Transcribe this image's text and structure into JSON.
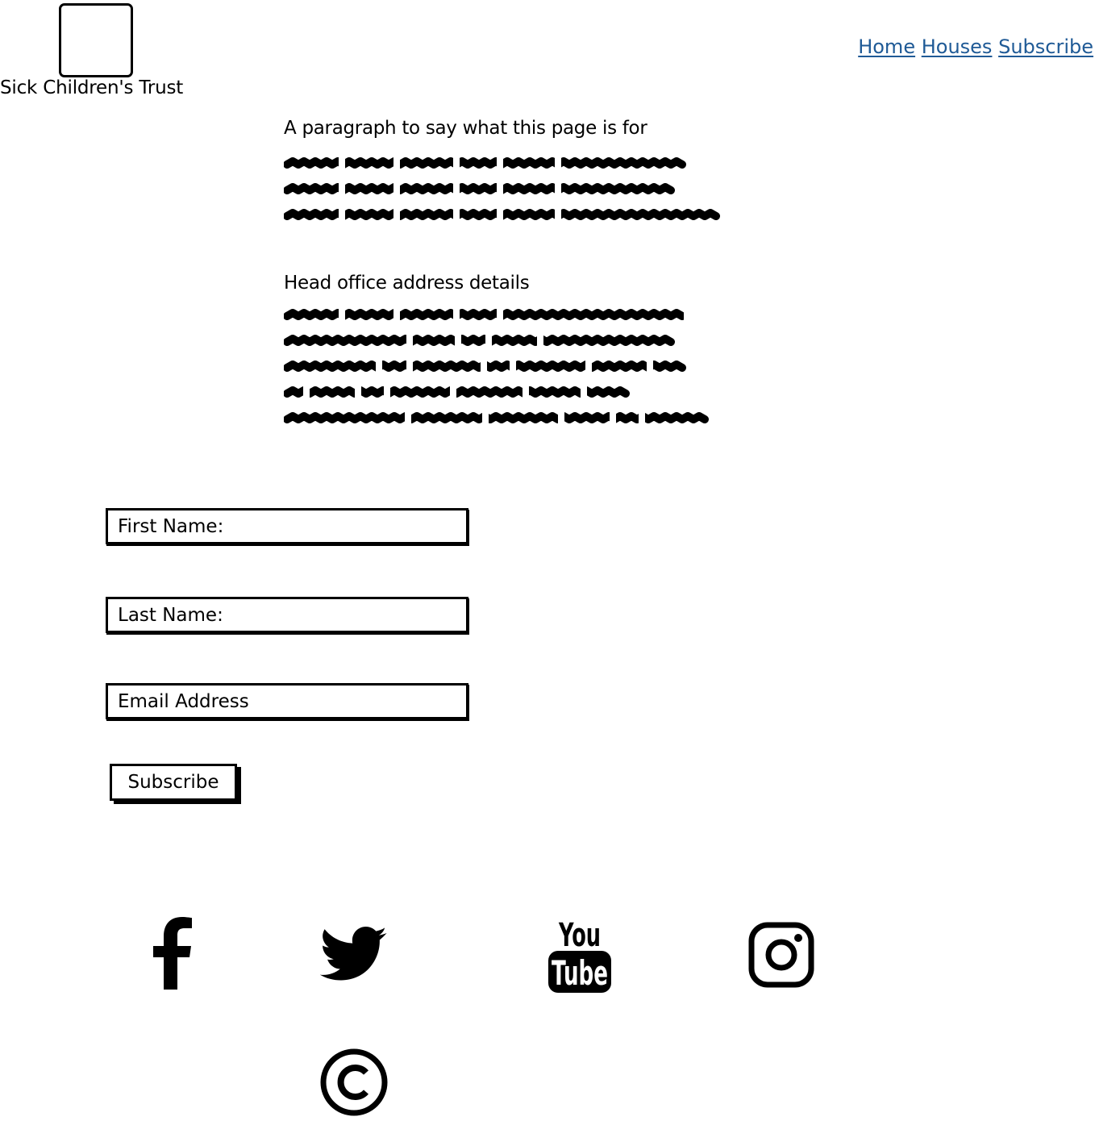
{
  "header": {
    "logo_text": "Sick Children's Trust",
    "nav": [
      {
        "label": "Home"
      },
      {
        "label": "Houses"
      },
      {
        "label": "Subscribe"
      }
    ]
  },
  "intro": {
    "heading": "A paragraph to say what this page is for"
  },
  "address": {
    "heading": "Head office address details"
  },
  "form": {
    "first_name_placeholder": "First Name:",
    "last_name_placeholder": "Last Name:",
    "email_placeholder": "Email Address",
    "submit_label": "Subscribe"
  },
  "footer": {
    "social_icons": [
      "facebook-icon",
      "twitter-icon",
      "youtube-icon",
      "instagram-icon"
    ],
    "copyright_icon": "copyright-icon"
  },
  "colors": {
    "link": "#1f5a96",
    "ink": "#000000",
    "background": "#ffffff"
  }
}
